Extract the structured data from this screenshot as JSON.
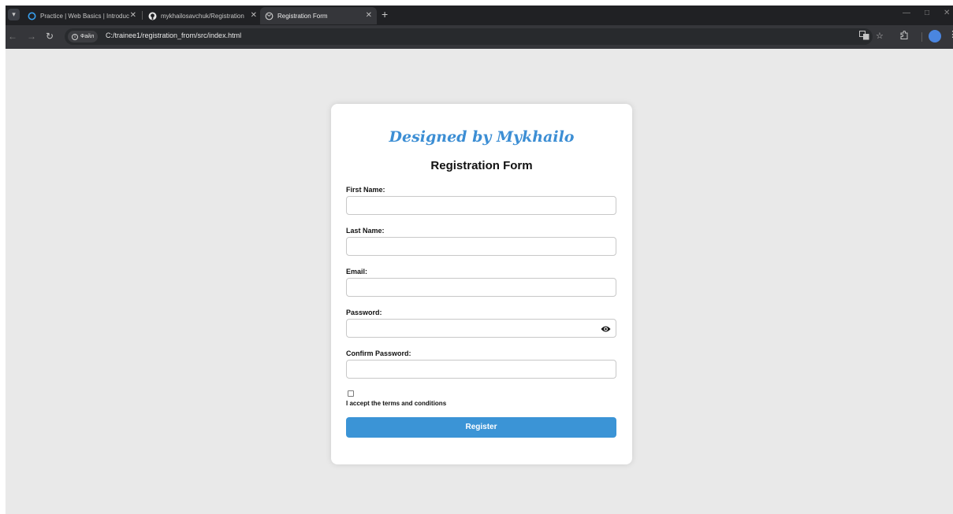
{
  "browser": {
    "tabs": [
      {
        "title": "Practice | Web Basics | Introduc",
        "active": false
      },
      {
        "title": "mykhailosavchuk/Registration",
        "active": false
      },
      {
        "title": "Registration Form",
        "active": true
      }
    ],
    "address": {
      "chip": "Файл",
      "url": "C:/trainee1/registration_from/src/index.html"
    },
    "icons": {
      "menu": "chevron-down-icon",
      "back": "arrow-left-icon",
      "forward": "arrow-right-icon",
      "reload": "reload-icon",
      "translate": "translate-icon",
      "bookmark": "star-icon",
      "extensions": "puzzle-icon",
      "more": "kebab-menu-icon"
    }
  },
  "form": {
    "designer": "Designed by Mykhailo",
    "title": "Registration Form",
    "fields": {
      "first_name": {
        "label": "First Name:",
        "value": ""
      },
      "last_name": {
        "label": "Last Name:",
        "value": ""
      },
      "email": {
        "label": "Email:",
        "value": ""
      },
      "password": {
        "label": "Password:",
        "value": ""
      },
      "confirm_password": {
        "label": "Confirm Password:",
        "value": ""
      }
    },
    "terms": {
      "label": "I accept the terms and conditions",
      "checked": false
    },
    "submit_label": "Register",
    "colors": {
      "accent": "#3b94d6",
      "designer_text": "#3c8ed4",
      "page_background": "#e9e9e9",
      "card_background": "#ffffff"
    }
  }
}
